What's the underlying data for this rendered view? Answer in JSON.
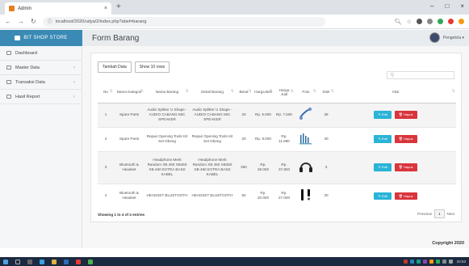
{
  "browser": {
    "tab_title": "Admin",
    "tab_close": "×",
    "new_tab": "+",
    "url": "localhost/2020/udya/2/index.php?abel=barang",
    "win_min": "–",
    "win_max": "□",
    "win_close": "×"
  },
  "app": {
    "brand": "BIT SHOP STORE",
    "page_title": "Form Barang",
    "user_label": "Pengelola ▾"
  },
  "sidebar": {
    "items": [
      {
        "label": "Dashboard"
      },
      {
        "label": "Master Data",
        "chev": "‹"
      },
      {
        "label": "Transaksi Data",
        "chev": "‹"
      },
      {
        "label": "Hasil Report",
        "chev": "‹"
      }
    ]
  },
  "toolbar": {
    "add_label": "Tambah Data",
    "show_label": "Show 10 rows",
    "search_placeholder": "Q"
  },
  "table": {
    "headers": [
      "No",
      "Nama Kategori",
      "Nama Barang",
      "Detail Barang",
      "Berat",
      "Harga Beli",
      "Harga Jual",
      "Foto",
      "Stok",
      "Aksi"
    ],
    "rows": [
      {
        "no": "1",
        "kategori": "Spare Parts",
        "nama": "Audio Splitter U Shape - AUDIO CABANG MIC SPEAKER",
        "detail": "Audio Splitter U Shape - AUDIO CABANG MIC SPEAKER",
        "berat": "20",
        "beli": "Rp. 5.000",
        "jual": "Rp. 7.500",
        "stok": "38"
      },
      {
        "no": "2",
        "kategori": "Spare Parts",
        "nama": "Repair Opening Tools Kit Set Obeng",
        "detail": "Repair Opening Tools Kit Set Obeng",
        "berat": "20",
        "beli": "Rp. 8.000",
        "jual": "Rp. 11.880",
        "stok": "40"
      },
      {
        "no": "3",
        "kategori": "Bluetooth & Headset",
        "nama": "Headphone Merk Random XB 450 XB450 XB-450 EXTRA BASS KABEL",
        "detail": "Headphone Merk Random XB 450 XB450 XB-450 EXTRA BASS KABEL",
        "berat": "350",
        "beli": "Rp. 28.000",
        "jual": "Rp. 37.800",
        "stok": "3"
      },
      {
        "no": "4",
        "kategori": "Bluetooth & Headset",
        "nama": "HEADSET BLUETOOTH",
        "detail": "HEADSET BLUETOOTH",
        "berat": "50",
        "beli": "Rp. 20.000",
        "jual": "Rp. 27.000",
        "stok": "30"
      }
    ],
    "edit_label": "✎ Edit",
    "delete_label": "🗑 Hapus"
  },
  "footer_info": "Showing 1 to 4 of 4 entries",
  "pager": {
    "prev": "Previous",
    "page": "1",
    "next": "Next"
  },
  "copyright": "Copyright 2020",
  "taskbar": {
    "clock": "20:53"
  }
}
